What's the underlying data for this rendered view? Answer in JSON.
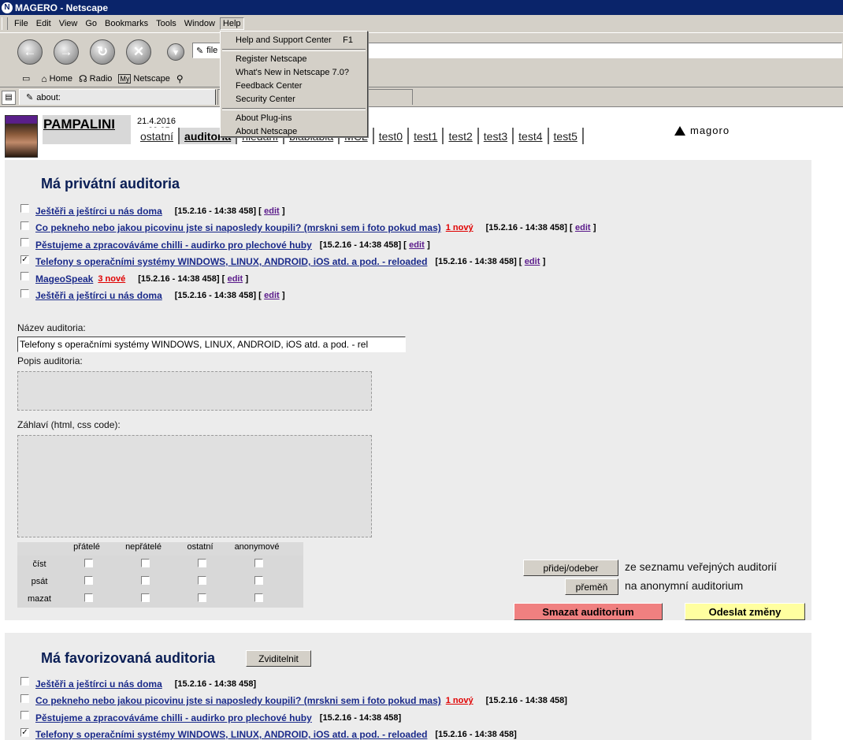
{
  "window": {
    "title": "MAGERO - Netscape",
    "app_icon": "N"
  },
  "menubar": {
    "items": [
      "File",
      "Edit",
      "View",
      "Go",
      "Bookmarks",
      "Tools",
      "Window",
      "Help"
    ]
  },
  "help_menu": {
    "items": [
      {
        "label": "Help and Support Center",
        "shortcut": "F1"
      },
      {
        "label": "Register Netscape"
      },
      {
        "label": "What's New in Netscape 7.0?"
      },
      {
        "label": "Feedback Center"
      },
      {
        "label": "Security Center"
      },
      {
        "label": "About Plug-ins"
      },
      {
        "label": "About Netscape"
      }
    ]
  },
  "navbar": {
    "url_prefix": "file"
  },
  "personal_bar": {
    "home": "Home",
    "radio": "Radio",
    "my_netscape": "Netscape",
    "my_badge": "My"
  },
  "tabs": {
    "active_tab": "about:"
  },
  "page": {
    "username": "PAMPALINI",
    "datetime": "21.4.2016 --- 23:35",
    "nav": [
      "ostatní",
      "auditoria",
      "hledání",
      "blablabla",
      "MCL",
      "test0",
      "test1",
      "test2",
      "test3",
      "test4",
      "test5"
    ],
    "brand": "magoro"
  },
  "private": {
    "title": "Má privátní auditoria",
    "rows": [
      {
        "title": "Ještěři a ještírci u nás doma",
        "new": "",
        "stamp": "[15.2.16 - 14:38 458]",
        "edit": "edit",
        "checked": ""
      },
      {
        "title": "Co pekneho nebo jakou picovinu jste si naposledy koupili? (mrskni sem i foto pokud mas)",
        "new": "1 nový",
        "stamp": "[15.2.16 - 14:38 458]",
        "edit": "edit",
        "checked": ""
      },
      {
        "title": "Pěstujeme a zpracováváme chilli - audirko pro plechové huby",
        "new": "",
        "stamp": "[15.2.16 - 14:38 458]",
        "edit": "edit",
        "checked": ""
      },
      {
        "title": "Telefony s operačními systémy WINDOWS, LINUX, ANDROID, iOS atd. a pod. - reloaded",
        "new": "",
        "stamp": "[15.2.16 - 14:38 458]",
        "edit": "edit",
        "checked": "✓"
      },
      {
        "title": "MageoSpeak",
        "new": "3 nové",
        "stamp": "[15.2.16 - 14:38 458]",
        "edit": "edit",
        "checked": ""
      },
      {
        "title": "Ještěři a ještírci u nás doma",
        "new": "",
        "stamp": "[15.2.16 - 14:38 458]",
        "edit": "edit",
        "checked": ""
      }
    ],
    "bracket_open": "[",
    "bracket_close": "]"
  },
  "form": {
    "name_label": "Název auditoria:",
    "name_value": "Telefony s operačními systémy WINDOWS, LINUX, ANDROID, iOS atd. a pod. - rel",
    "desc_label": "Popis auditoria:",
    "header_label": "Záhlaví (html, css code):",
    "perm_columns": [
      "přátelé",
      "nepřátelé",
      "ostatní",
      "anonymové"
    ],
    "perm_rows": [
      "číst",
      "psát",
      "mazat"
    ],
    "add_remove_button": "přidej/odeber",
    "add_remove_text": "ze seznamu veřejných auditorií",
    "change_button": "přeměň",
    "change_text": "na anonymní auditorium",
    "delete_button": "Smazat auditorium",
    "submit_button": "Odeslat změny",
    "delete_color": "#f08080",
    "submit_color": "#ffffa0"
  },
  "favorites": {
    "title": "Má favorizovaná auditoria",
    "show_button": "Zviditelnit",
    "rows": [
      {
        "title": "Ještěři a ještírci u nás doma",
        "new": "",
        "stamp": "[15.2.16 - 14:38 458]",
        "checked": ""
      },
      {
        "title": "Co pekneho nebo jakou picovinu jste si naposledy koupili? (mrskni sem i foto pokud mas)",
        "new": "1 nový",
        "stamp": "[15.2.16 - 14:38 458]",
        "checked": ""
      },
      {
        "title": "Pěstujeme a zpracováváme chilli - audirko pro plechové huby",
        "new": "",
        "stamp": "[15.2.16 - 14:38 458]",
        "checked": ""
      },
      {
        "title": "Telefony s operačními systémy WINDOWS, LINUX, ANDROID, iOS atd. a pod. - reloaded",
        "new": "",
        "stamp": "[15.2.16 - 14:38 458]",
        "checked": "✓"
      }
    ]
  }
}
